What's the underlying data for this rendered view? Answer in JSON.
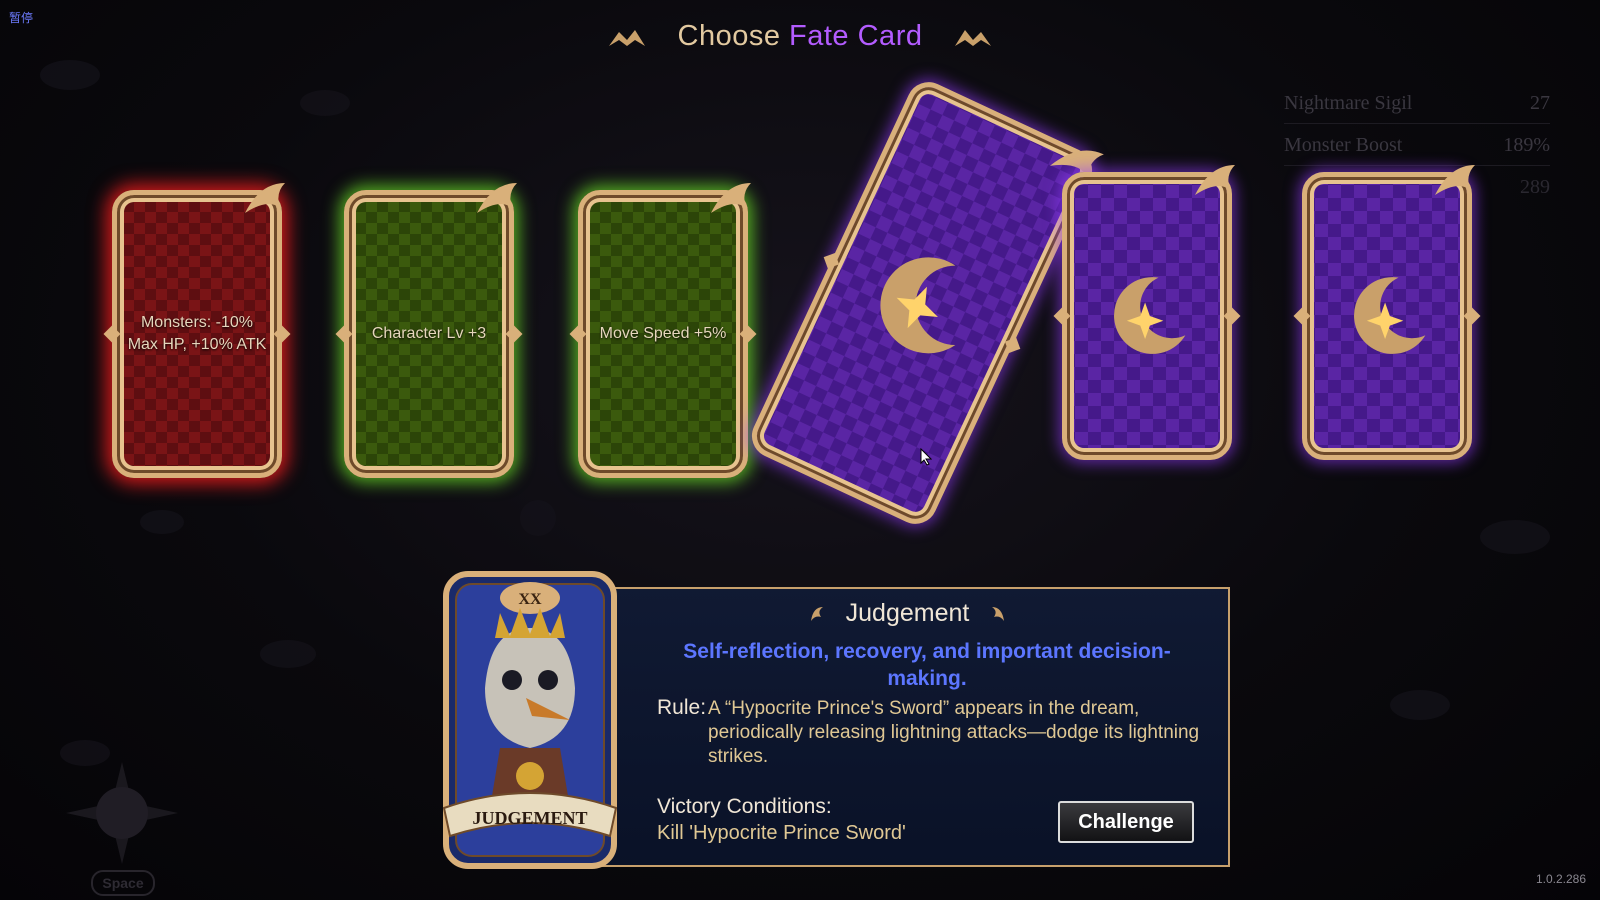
{
  "pause_label": "暂停",
  "header": {
    "prefix": "Choose",
    "highlight": "Fate Card"
  },
  "stats": [
    {
      "label": "Nightmare Sigil",
      "value": "27"
    },
    {
      "label": "Monster Boost",
      "value": "189%"
    },
    {
      "label": "",
      "value": "289"
    }
  ],
  "cards": [
    {
      "text": "Monsters: -10% Max HP, +10% ATK",
      "color": "red"
    },
    {
      "text": "Character Lv +3",
      "color": "green"
    },
    {
      "text": "Move Speed +5%",
      "color": "green"
    },
    {
      "text": "",
      "color": "purple",
      "state": "hovered"
    },
    {
      "text": "",
      "color": "purple"
    },
    {
      "text": "",
      "color": "purple"
    }
  ],
  "detail": {
    "numeral": "XX",
    "banner": "JUDGEMENT",
    "title": "Judgement",
    "subtitle": "Self-reflection, recovery, and important decision-making.",
    "rule_label": "Rule:",
    "rule_text": "A “Hypocrite Prince's Sword” appears in the dream, periodically releasing lightning attacks—dodge its lightning strikes.",
    "victory_label": "Victory Conditions:",
    "victory_text": "Kill 'Hypocrite Prince Sword'",
    "challenge_label": "Challenge"
  },
  "space_label": "Space",
  "version": "1.0.2.286",
  "colors": {
    "gold": "#d9b07a",
    "purple_accent": "#b35cff",
    "subtitle_blue": "#5c76ff"
  }
}
